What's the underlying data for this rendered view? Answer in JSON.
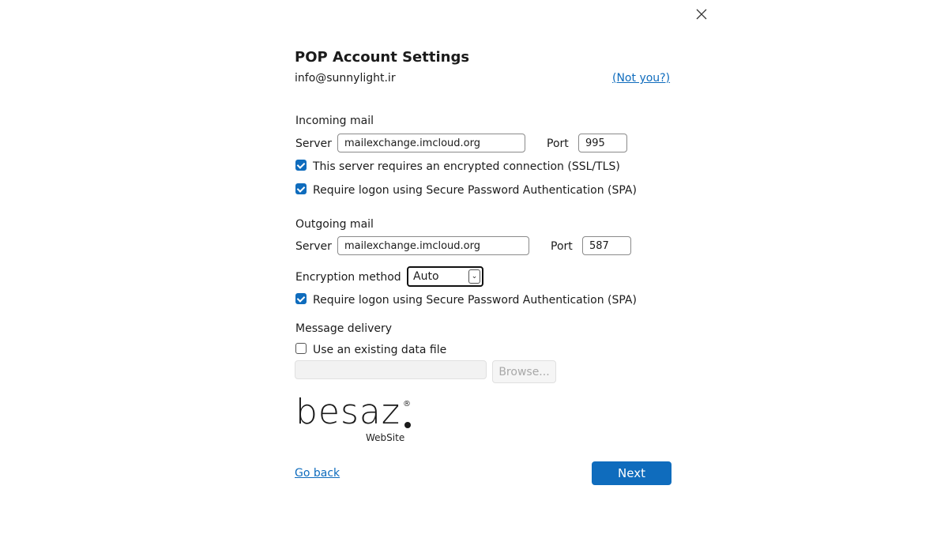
{
  "dialog": {
    "title": "POP Account Settings",
    "email": "info@sunnylight.ir",
    "not_you": "(Not you?)",
    "close_icon": "close-icon"
  },
  "incoming": {
    "heading": "Incoming mail",
    "server_label": "Server",
    "server_value": "mailexchange.imcloud.org",
    "port_label": "Port",
    "port_value": "995",
    "ssl_label": "This server requires an encrypted connection (SSL/TLS)",
    "ssl_checked": true,
    "spa_label": "Require logon using Secure Password Authentication (SPA)",
    "spa_checked": true
  },
  "outgoing": {
    "heading": "Outgoing mail",
    "server_label": "Server",
    "server_value": "mailexchange.imcloud.org",
    "port_label": "Port",
    "port_value": "587",
    "encryption_label": "Encryption method",
    "encryption_value": "Auto",
    "spa_label": "Require logon using Secure Password Authentication (SPA)",
    "spa_checked": true
  },
  "delivery": {
    "heading": "Message delivery",
    "existing_label": "Use an existing data file",
    "existing_checked": false,
    "file_path": "",
    "browse_label": "Browse..."
  },
  "logo": {
    "text": "besaz",
    "sub": "WebSite",
    "mark": "®"
  },
  "footer": {
    "back_label": "Go back",
    "next_label": "Next"
  },
  "colors": {
    "accent": "#0f6cbd"
  }
}
